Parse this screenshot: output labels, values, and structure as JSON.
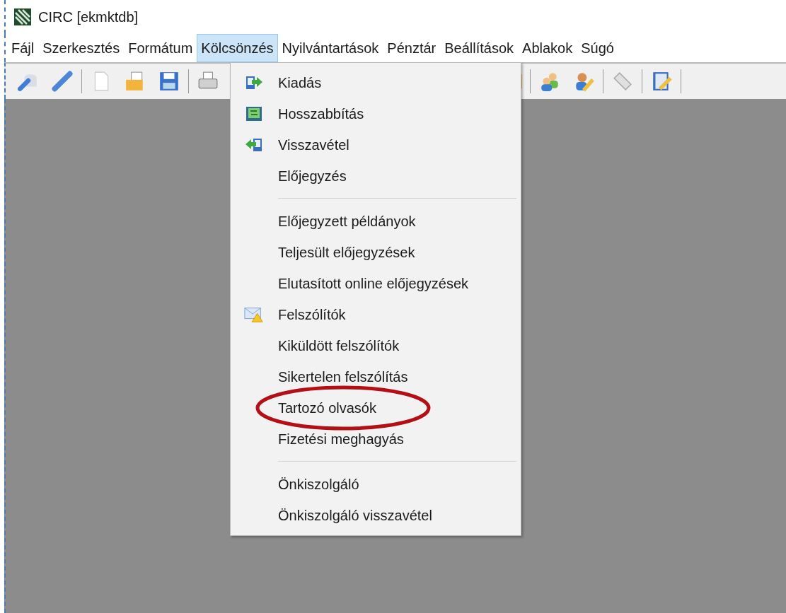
{
  "window": {
    "title": "CIRC [ekmktdb]"
  },
  "menubar": [
    {
      "label": "Fájl",
      "selected": false
    },
    {
      "label": "Szerkesztés",
      "selected": false
    },
    {
      "label": "Formátum",
      "selected": false
    },
    {
      "label": "Kölcsönzés",
      "selected": true
    },
    {
      "label": "Nyilvántartások",
      "selected": false
    },
    {
      "label": "Pénztár",
      "selected": false
    },
    {
      "label": "Beállítások",
      "selected": false
    },
    {
      "label": "Ablakok",
      "selected": false
    },
    {
      "label": "Súgó",
      "selected": false
    }
  ],
  "menu": [
    {
      "kind": "item",
      "label": "Kiadás",
      "highlighted": false
    },
    {
      "kind": "item",
      "label": "Hosszabbítás",
      "highlighted": false
    },
    {
      "kind": "item",
      "label": "Visszavétel",
      "highlighted": false
    },
    {
      "kind": "item",
      "label": "Előjegyzés",
      "highlighted": false
    },
    {
      "kind": "separator"
    },
    {
      "kind": "item",
      "label": "Előjegyzett példányok",
      "highlighted": false
    },
    {
      "kind": "item",
      "label": "Teljesült előjegyzések",
      "highlighted": false
    },
    {
      "kind": "item",
      "label": "Elutasított online előjegyzések",
      "highlighted": false
    },
    {
      "kind": "item",
      "label": "Felszólítók",
      "highlighted": false
    },
    {
      "kind": "item",
      "label": "Kiküldött felszólítók",
      "highlighted": false
    },
    {
      "kind": "item",
      "label": "Sikertelen felszólítás",
      "highlighted": false
    },
    {
      "kind": "item",
      "label": "Tartozó olvasók",
      "highlighted": true
    },
    {
      "kind": "item",
      "label": "Fizetési meghagyás",
      "highlighted": false
    },
    {
      "kind": "separator"
    },
    {
      "kind": "item",
      "label": "Önkiszolgáló",
      "highlighted": false
    },
    {
      "kind": "item",
      "label": "Önkiszolgáló visszavétel",
      "highlighted": false
    }
  ]
}
